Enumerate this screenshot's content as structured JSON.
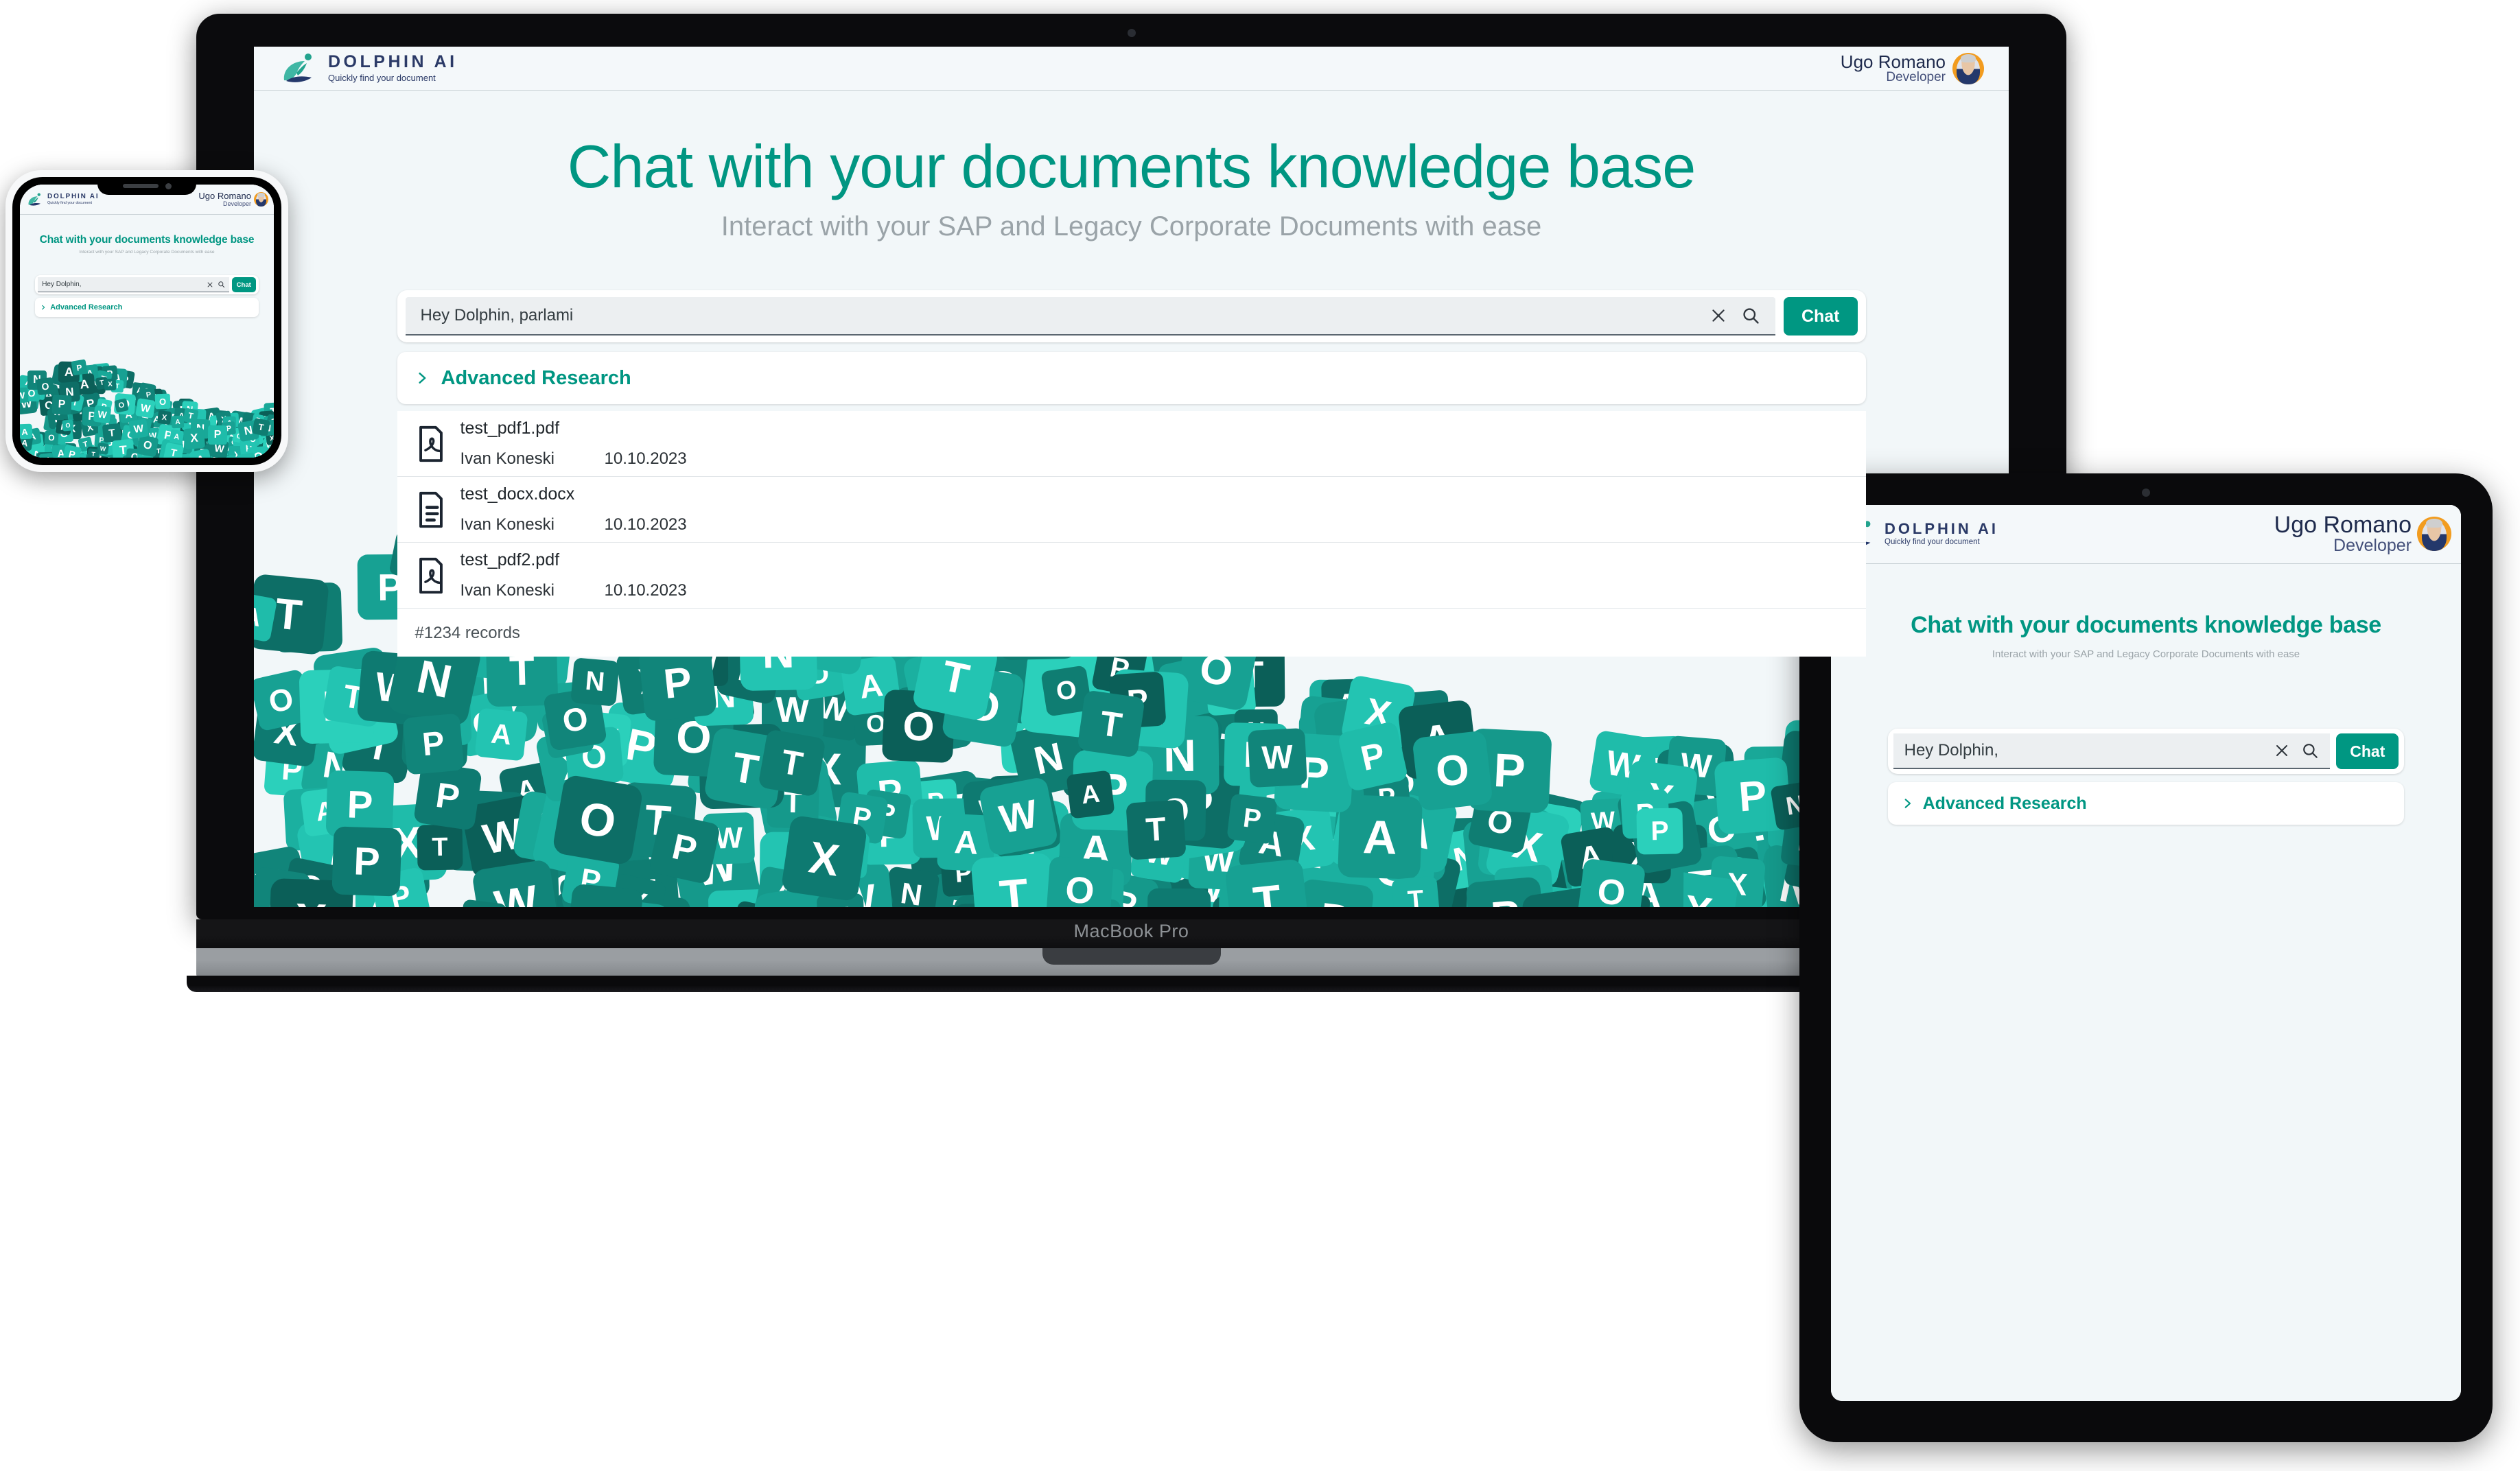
{
  "brand": {
    "name": "DOLPHIN AI",
    "tagline": "Quickly find your document",
    "logo_icon": "dolphin-logo-icon"
  },
  "user": {
    "name": "Ugo Romano",
    "role": "Developer",
    "avatar_icon": "user-avatar"
  },
  "hero": {
    "title": "Chat with your documents knowledge base",
    "subtitle": "Interact with your SAP and Legacy Corporate Documents with ease"
  },
  "search": {
    "value_desktop": "Hey Dolphin, parlami",
    "value_compact": "Hey Dolphin,",
    "placeholder": "Hey Dolphin,",
    "clear_icon": "close-icon",
    "search_icon": "search-icon",
    "chat_button": "Chat"
  },
  "advanced": {
    "label": "Advanced Research",
    "chevron_icon": "chevron-right-icon"
  },
  "results": {
    "rows": [
      {
        "icon": "pdf-file-icon",
        "name": "test_pdf1.pdf",
        "author": "Ivan Koneski",
        "date": "10.10.2023"
      },
      {
        "icon": "docx-file-icon",
        "name": "test_docx.docx",
        "author": "Ivan Koneski",
        "date": "10.10.2023"
      },
      {
        "icon": "pdf-file-icon",
        "name": "test_pdf2.pdf",
        "author": "Ivan Koneski",
        "date": "10.10.2023"
      }
    ],
    "footer": "#1234 records"
  },
  "devices": {
    "laptop_label": "MacBook Pro"
  },
  "colors": {
    "teal": "#009682",
    "chat_button": "#009782",
    "brand_navy": "#2b3a67",
    "screen_bg": "#f2f7f9",
    "subtitle_gray": "#9aa3a8",
    "avatar_ring": "#f29c1f"
  },
  "hero_art": {
    "name": "document-tiles-wave",
    "letters": [
      "W",
      "X",
      "P",
      "N",
      "T",
      "O",
      "A",
      "P"
    ]
  }
}
